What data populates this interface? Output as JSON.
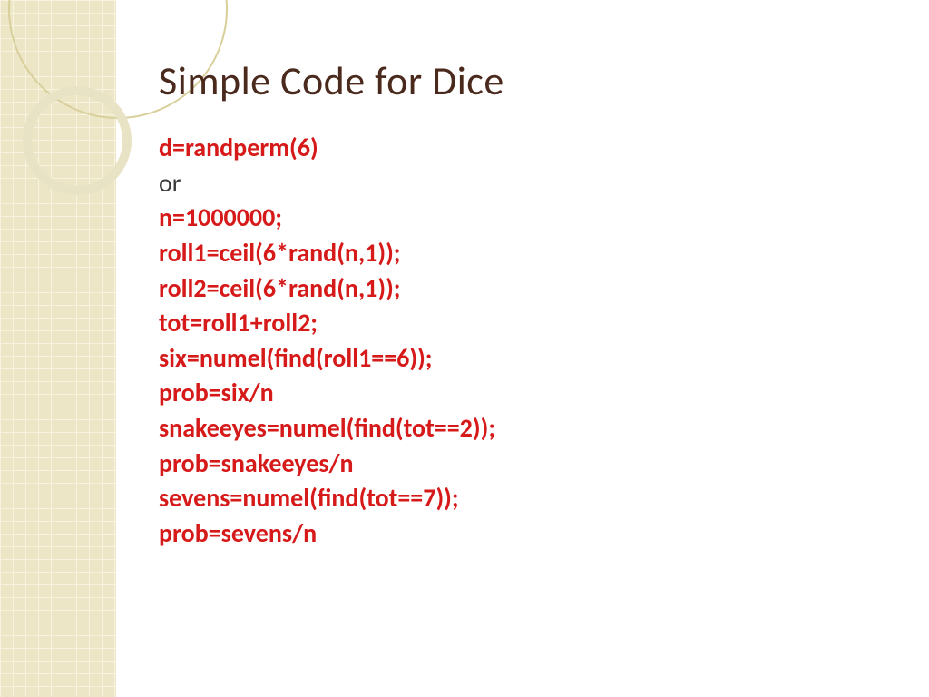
{
  "title": "Simple Code for Dice",
  "lines": [
    {
      "text": "d=randperm(6)",
      "style": "code"
    },
    {
      "text": "or",
      "style": "plain"
    },
    {
      "text": "n=1000000;",
      "style": "code"
    },
    {
      "text": "roll1=ceil(6*rand(n,1));",
      "style": "code"
    },
    {
      "text": "roll2=ceil(6*rand(n,1));",
      "style": "code"
    },
    {
      "text": "tot=roll1+roll2;",
      "style": "code"
    },
    {
      "text": "six=numel(find(roll1==6));",
      "style": "code"
    },
    {
      "text": "prob=six/n",
      "style": "code"
    },
    {
      "text": "snakeeyes=numel(find(tot==2));",
      "style": "code"
    },
    {
      "text": "prob=snakeeyes/n",
      "style": "code"
    },
    {
      "text": "sevens=numel(find(tot==7));",
      "style": "code"
    },
    {
      "text": "prob=sevens/n",
      "style": "code"
    }
  ],
  "colors": {
    "title": "#4b2a1e",
    "code": "#d61a1a",
    "plain": "#3a3a3a",
    "band": "#e3d9a8"
  }
}
